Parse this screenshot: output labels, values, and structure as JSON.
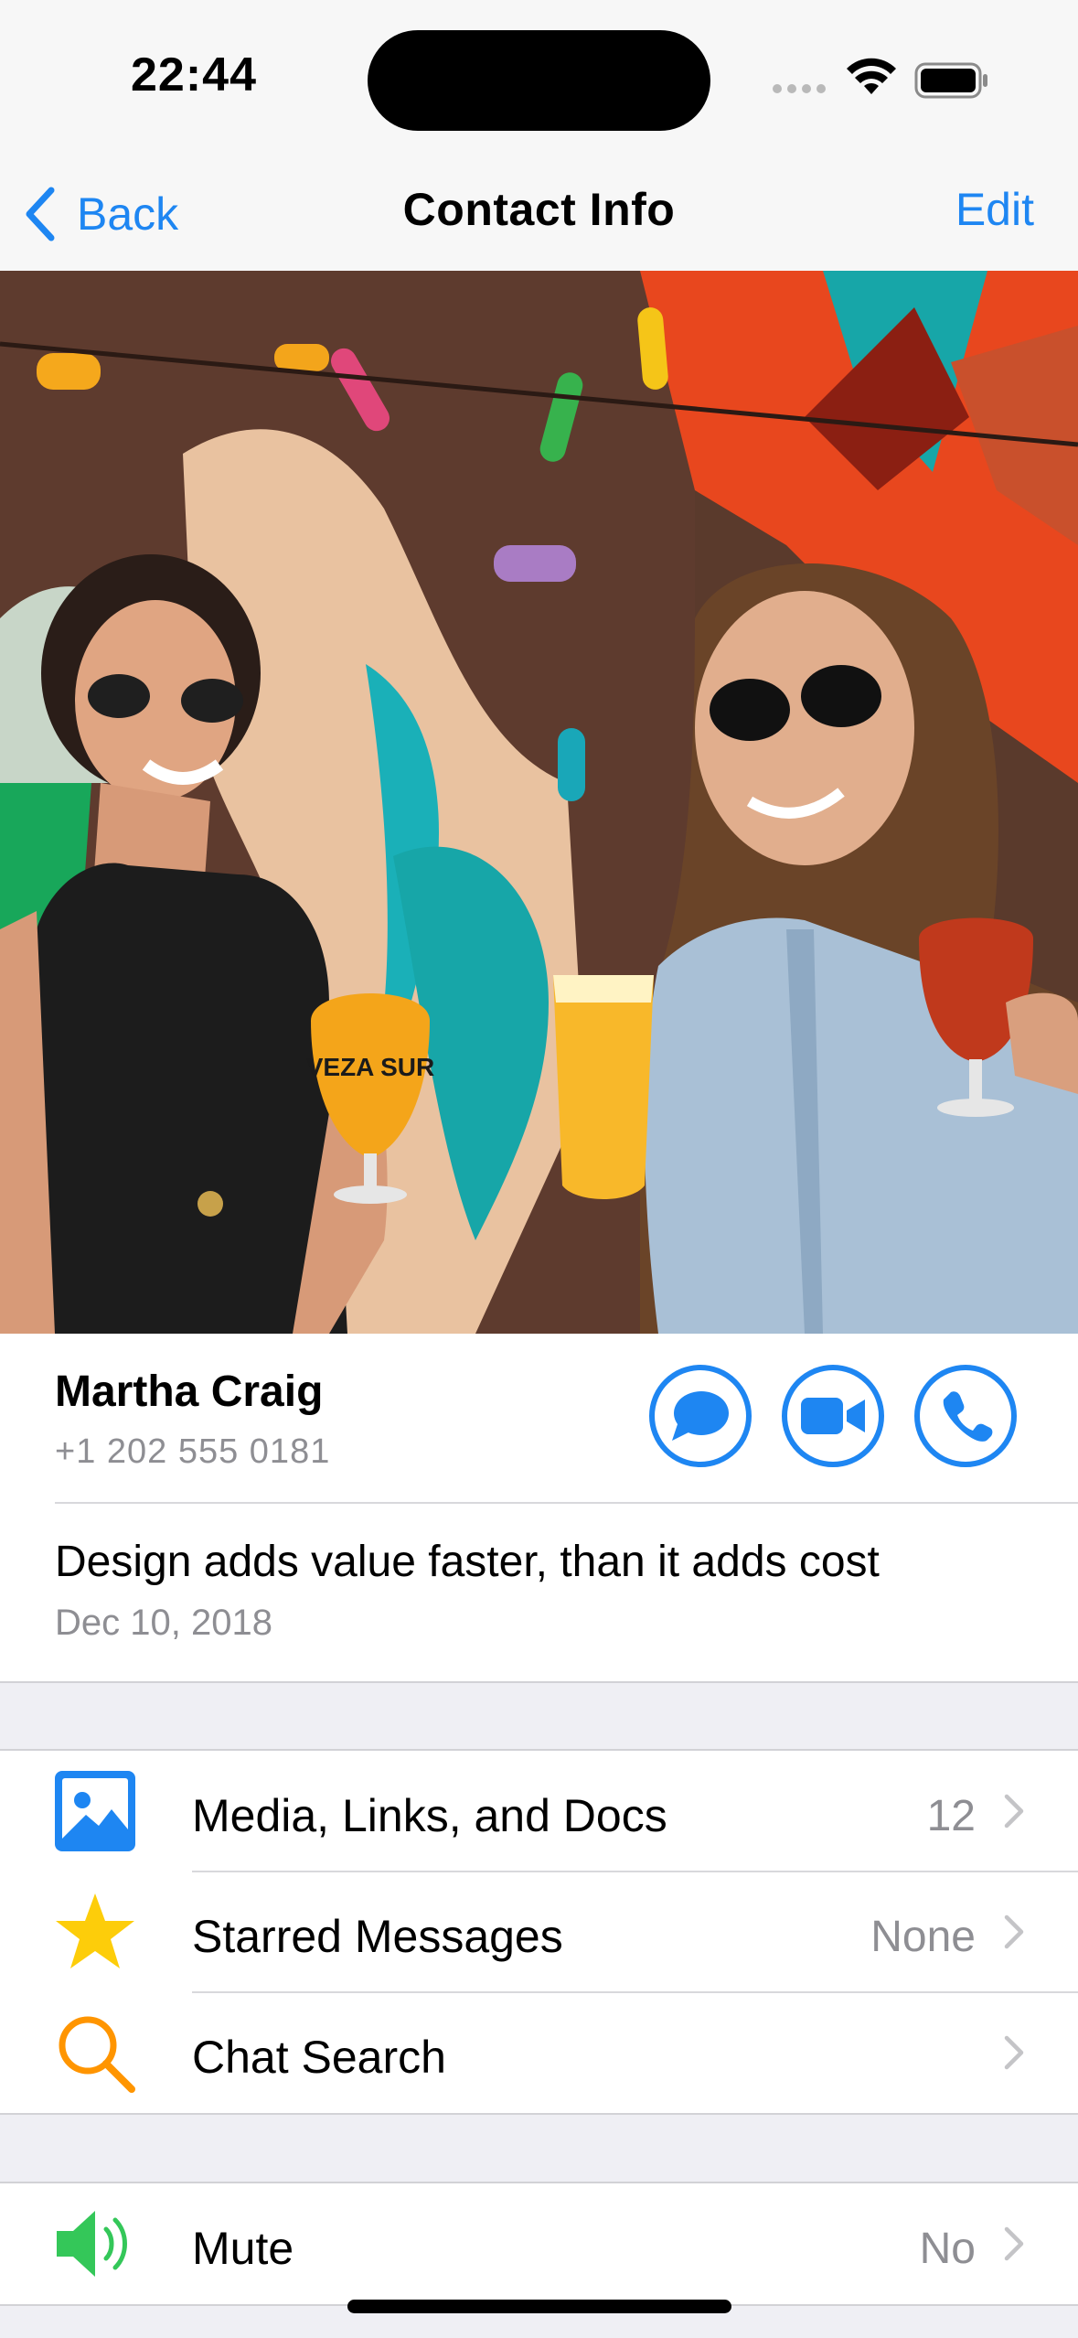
{
  "status_bar": {
    "time": "22:44"
  },
  "nav": {
    "back_label": "Back",
    "title": "Contact Info",
    "edit_label": "Edit"
  },
  "contact": {
    "name": "Martha Craig",
    "phone": "+1 202 555 0181",
    "about": "Design adds value faster, than it adds cost",
    "about_date": "Dec 10, 2018"
  },
  "photo": {
    "glass_text": "VEZA SUR"
  },
  "actions": [
    {
      "icon": "message-icon"
    },
    {
      "icon": "video-icon"
    },
    {
      "icon": "phone-icon"
    }
  ],
  "rows": {
    "media": {
      "label": "Media, Links, and Docs",
      "value": "12",
      "icon": "photo-icon",
      "color": "#1e86f2"
    },
    "starred": {
      "label": "Starred Messages",
      "value": "None",
      "icon": "star-icon",
      "color": "#fdcd0a"
    },
    "search": {
      "label": "Chat Search",
      "value": "",
      "icon": "search-icon",
      "color": "#ff9500"
    },
    "mute": {
      "label": "Mute",
      "value": "No",
      "icon": "speaker-icon",
      "color": "#34c759"
    }
  },
  "colors": {
    "accent": "#1e86f2",
    "secondary_text": "#8e8e93",
    "background": "#efeff4"
  }
}
